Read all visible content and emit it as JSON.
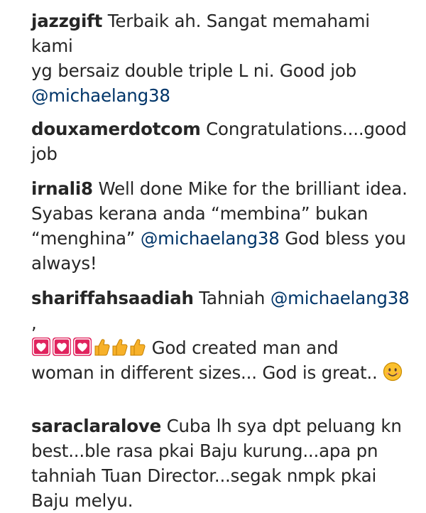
{
  "colors": {
    "text": "#262626",
    "mention": "#003569",
    "heart_box": "#e0245e",
    "thumbs": "#f7b12a",
    "smiley": "#fbc02d"
  },
  "comments": [
    {
      "username": "jazzgift",
      "line1": "Terbaik ah. Sangat memahami kami",
      "line2": "yg bersaiz double triple L ni. Good job",
      "mention": "@michaelang38"
    },
    {
      "username": "douxamerdotcom",
      "line1": "Congratulations....good",
      "line2": "job"
    },
    {
      "username": "irnali8",
      "line1": "Well done Mike for the brilliant idea.",
      "line2": "Syabas kerana anda “membina” bukan",
      "line3_pre": "“menghina”",
      "mention": "@michaelang38",
      "line3_post": "God bless you",
      "line4": "always!"
    },
    {
      "username": "shariffahsaadiah",
      "text_pre": "Tahniah",
      "mention": "@michaelang38",
      "text_comma": ",",
      "emojis": [
        "heart-box-icon",
        "heart-box-icon",
        "heart-box-icon",
        "thumbs-up-icon",
        "thumbs-up-icon",
        "thumbs-up-icon",
        "smiling-face-icon"
      ],
      "line2": "God created man and",
      "line3": "woman in different sizes... God is great.."
    },
    {
      "username": "saraclaralove",
      "line1": "Cuba lh sya dpt peluang kn",
      "line2": "best...ble rasa pkai Baju kurung...apa pn",
      "line3": "tahniah Tuan Director...segak nmpk pkai",
      "line4": "Baju melyu."
    }
  ]
}
